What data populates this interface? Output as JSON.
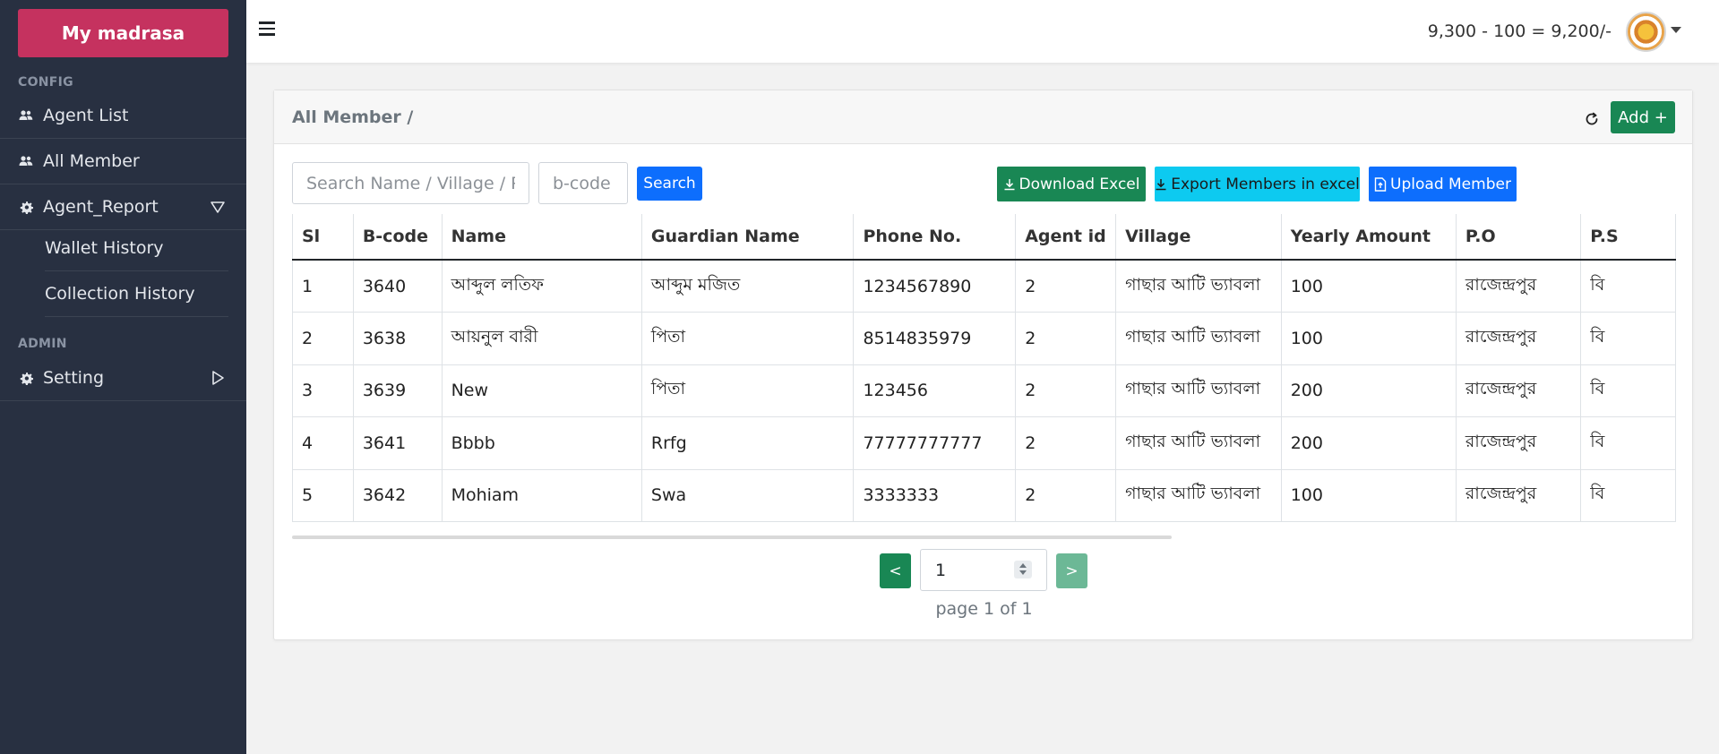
{
  "sidebar": {
    "brand": "My madrasa",
    "config_title": "CONFIG",
    "admin_title": "ADMIN",
    "items": [
      {
        "label": "Agent List",
        "icon": "users-icon"
      },
      {
        "label": "All Member",
        "icon": "users-icon"
      },
      {
        "label": "Agent_Report",
        "icon": "gear-icon"
      },
      {
        "label": "Setting",
        "icon": "gear-icon"
      }
    ],
    "sub_items": [
      {
        "label": "Wallet History"
      },
      {
        "label": "Collection History"
      }
    ]
  },
  "topbar": {
    "balance": "9,300 - 100 = 9,200/-"
  },
  "card": {
    "title": "All Member /",
    "add_label": "Add +"
  },
  "search": {
    "placeholder": "Search Name / Village / Phone",
    "bcode_placeholder": "b-code",
    "button": "Search"
  },
  "actions": {
    "download_excel": "Download Excel",
    "export_members": "Export Members in excel",
    "upload_member": "Upload Member"
  },
  "table": {
    "headers": [
      "Sl",
      "B-code",
      "Name",
      "Guardian Name",
      "Phone No.",
      "Agent id",
      "Village",
      "Yearly Amount",
      "P.O",
      "P.S"
    ],
    "rows": [
      [
        "1",
        "3640",
        "আব্দুল লতিফ",
        "আব্দুম মজিত",
        "1234567890",
        "2",
        "গাছার আটি ভ্যাবলা",
        "100",
        "রাজেন্দ্রপুর",
        "বি"
      ],
      [
        "2",
        "3638",
        "আয়নুল বারী",
        "পিতা",
        "8514835979",
        "2",
        "গাছার আটি ভ্যাবলা",
        "100",
        "রাজেন্দ্রপুর",
        "বি"
      ],
      [
        "3",
        "3639",
        "New",
        "পিতা",
        "123456",
        "2",
        "গাছার আটি ভ্যাবলা",
        "200",
        "রাজেন্দ্রপুর",
        "বি"
      ],
      [
        "4",
        "3641",
        "Bbbb",
        "Rrfg",
        "77777777777",
        "2",
        "গাছার আটি ভ্যাবলা",
        "200",
        "রাজেন্দ্রপুর",
        "বি"
      ],
      [
        "5",
        "3642",
        "Mohiam",
        "Swa",
        "3333333",
        "2",
        "গাছার আটি ভ্যাবলা",
        "100",
        "রাজেন্দ্রপুর",
        "বি"
      ]
    ]
  },
  "pagination": {
    "prev": "<",
    "next": ">",
    "current_page": "1",
    "info": "page 1 of 1"
  },
  "colors": {
    "brand": "#c5325f",
    "sidebar_bg": "#283041",
    "success": "#198754",
    "info": "#0dcaf0",
    "primary": "#0d6efd"
  }
}
